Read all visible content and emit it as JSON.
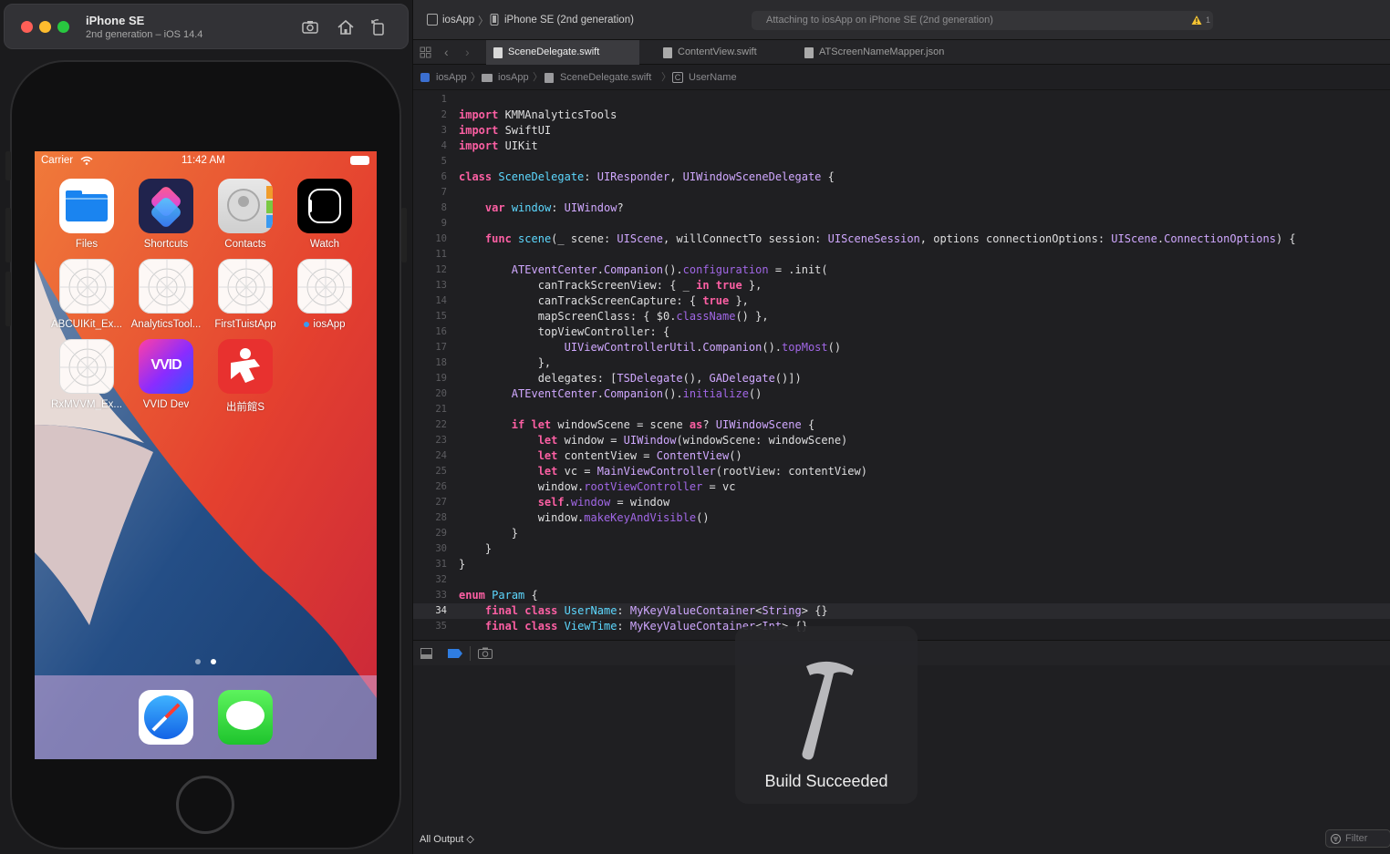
{
  "simulator": {
    "title": "iPhone SE",
    "subtitle": "2nd generation – iOS 14.4",
    "status": {
      "carrier": "Carrier",
      "time": "11:42 AM"
    },
    "apps": [
      {
        "label": "Files"
      },
      {
        "label": "Shortcuts"
      },
      {
        "label": "Contacts"
      },
      {
        "label": "Watch"
      },
      {
        "label": "ABCUIKit_Ex..."
      },
      {
        "label": "AnalyticsTool..."
      },
      {
        "label": "FirstTuistApp"
      },
      {
        "label": "iosApp"
      },
      {
        "label": "RxMVVM_Ex..."
      },
      {
        "label": "VVID Dev"
      },
      {
        "label": "出前館S"
      }
    ],
    "vvid_logo_text": "VVID"
  },
  "xcode": {
    "toolbar": {
      "scheme": "iosApp",
      "device": "iPhone SE (2nd generation)",
      "activity": "Attaching to iosApp on iPhone SE (2nd generation)",
      "warning_count": "1"
    },
    "tabs": [
      {
        "label": "SceneDelegate.swift"
      },
      {
        "label": "ContentView.swift"
      },
      {
        "label": "ATScreenNameMapper.json"
      }
    ],
    "jumpbar": [
      "iosApp",
      "iosApp",
      "SceneDelegate.swift",
      "UserName"
    ],
    "code_lines": [
      {
        "n": "1",
        "html": ""
      },
      {
        "n": "2",
        "html": "<span class=\"kw\">import</span> KMMAnalyticsTools"
      },
      {
        "n": "3",
        "html": "<span class=\"kw\">import</span> SwiftUI"
      },
      {
        "n": "4",
        "html": "<span class=\"kw\">import</span> UIKit"
      },
      {
        "n": "5",
        "html": ""
      },
      {
        "n": "6",
        "html": "<span class=\"kw\">class</span> <span class=\"ty\">SceneDelegate</span>: <span class=\"cl\">UIResponder</span>, <span class=\"cl\">UIWindowSceneDelegate</span> {"
      },
      {
        "n": "7",
        "html": ""
      },
      {
        "n": "8",
        "html": "    <span class=\"kw\">var</span> <span class=\"ty\">window</span>: <span class=\"cl\">UIWindow</span>?"
      },
      {
        "n": "9",
        "html": ""
      },
      {
        "n": "10",
        "html": "    <span class=\"kw\">func</span> <span class=\"ty\">scene</span>(_ scene: <span class=\"cl\">UIScene</span>, willConnectTo session: <span class=\"cl\">UISceneSession</span>, options connectionOptions: <span class=\"cl\">UIScene</span>.<span class=\"cl\">ConnectionOptions</span>) {"
      },
      {
        "n": "11",
        "html": ""
      },
      {
        "n": "12",
        "html": "        <span class=\"cl\">ATEventCenter</span>.<span class=\"cl\">Companion</span>().<span class=\"pr\">configuration</span> = .init("
      },
      {
        "n": "13",
        "html": "            canTrackScreenView: { _ <span class=\"kw\">in</span> <span class=\"kw\">true</span> },"
      },
      {
        "n": "14",
        "html": "            canTrackScreenCapture: { <span class=\"kw\">true</span> },"
      },
      {
        "n": "15",
        "html": "            mapScreenClass: { $0.<span class=\"pr\">className</span>() },"
      },
      {
        "n": "16",
        "html": "            topViewController: {"
      },
      {
        "n": "17",
        "html": "                <span class=\"cl\">UIViewControllerUtil</span>.<span class=\"cl\">Companion</span>().<span class=\"pr\">topMost</span>()"
      },
      {
        "n": "18",
        "html": "            },"
      },
      {
        "n": "19",
        "html": "            delegates: [<span class=\"cl\">TSDelegate</span>(), <span class=\"cl\">GADelegate</span>()])"
      },
      {
        "n": "20",
        "html": "        <span class=\"cl\">ATEventCenter</span>.<span class=\"cl\">Companion</span>().<span class=\"pr\">initialize</span>()"
      },
      {
        "n": "21",
        "html": ""
      },
      {
        "n": "22",
        "html": "        <span class=\"kw\">if</span> <span class=\"kw\">let</span> windowScene = scene <span class=\"kw\">as</span>? <span class=\"cl\">UIWindowScene</span> {"
      },
      {
        "n": "23",
        "html": "            <span class=\"kw\">let</span> window = <span class=\"cl\">UIWindow</span>(windowScene: windowScene)"
      },
      {
        "n": "24",
        "html": "            <span class=\"kw\">let</span> contentView = <span class=\"cl\">ContentView</span>()"
      },
      {
        "n": "25",
        "html": "            <span class=\"kw\">let</span> vc = <span class=\"cl\">MainViewController</span>(rootView: contentView)"
      },
      {
        "n": "26",
        "html": "            window.<span class=\"pr\">rootViewController</span> = vc"
      },
      {
        "n": "27",
        "html": "            <span class=\"kw\">self</span>.<span class=\"pr\">window</span> = window"
      },
      {
        "n": "28",
        "html": "            window.<span class=\"pr\">makeKeyAndVisible</span>()"
      },
      {
        "n": "29",
        "html": "        }"
      },
      {
        "n": "30",
        "html": "    }"
      },
      {
        "n": "31",
        "html": "}"
      },
      {
        "n": "32",
        "html": ""
      },
      {
        "n": "33",
        "html": "<span class=\"kw\">enum</span> <span class=\"ty\">Param</span> {"
      },
      {
        "n": "34",
        "html": "    <span class=\"kw\">final</span> <span class=\"kw\">class</span> <span class=\"ty\">UserName</span>: <span class=\"cl\">MyKeyValueContainer</span>&lt;<span class=\"cl\">String</span>&gt; {}"
      },
      {
        "n": "35",
        "html": "    <span class=\"kw\">final</span> <span class=\"kw\">class</span> <span class=\"ty\">ViewTime</span>: <span class=\"cl\">MyKeyValueContainer</span>&lt;<span class=\"cl\">Int</span>&gt; {}"
      }
    ],
    "current_line": "34",
    "hud": {
      "message": "Build Succeeded"
    },
    "console": {
      "output_label": "All Output ◇",
      "filter_placeholder": "Filter"
    }
  },
  "colors": {
    "accent": "#2f7de1",
    "keyword": "#fc5fa3",
    "type_decl": "#5dd8ff",
    "type_ref": "#d0a8ff",
    "property": "#a167e6"
  }
}
